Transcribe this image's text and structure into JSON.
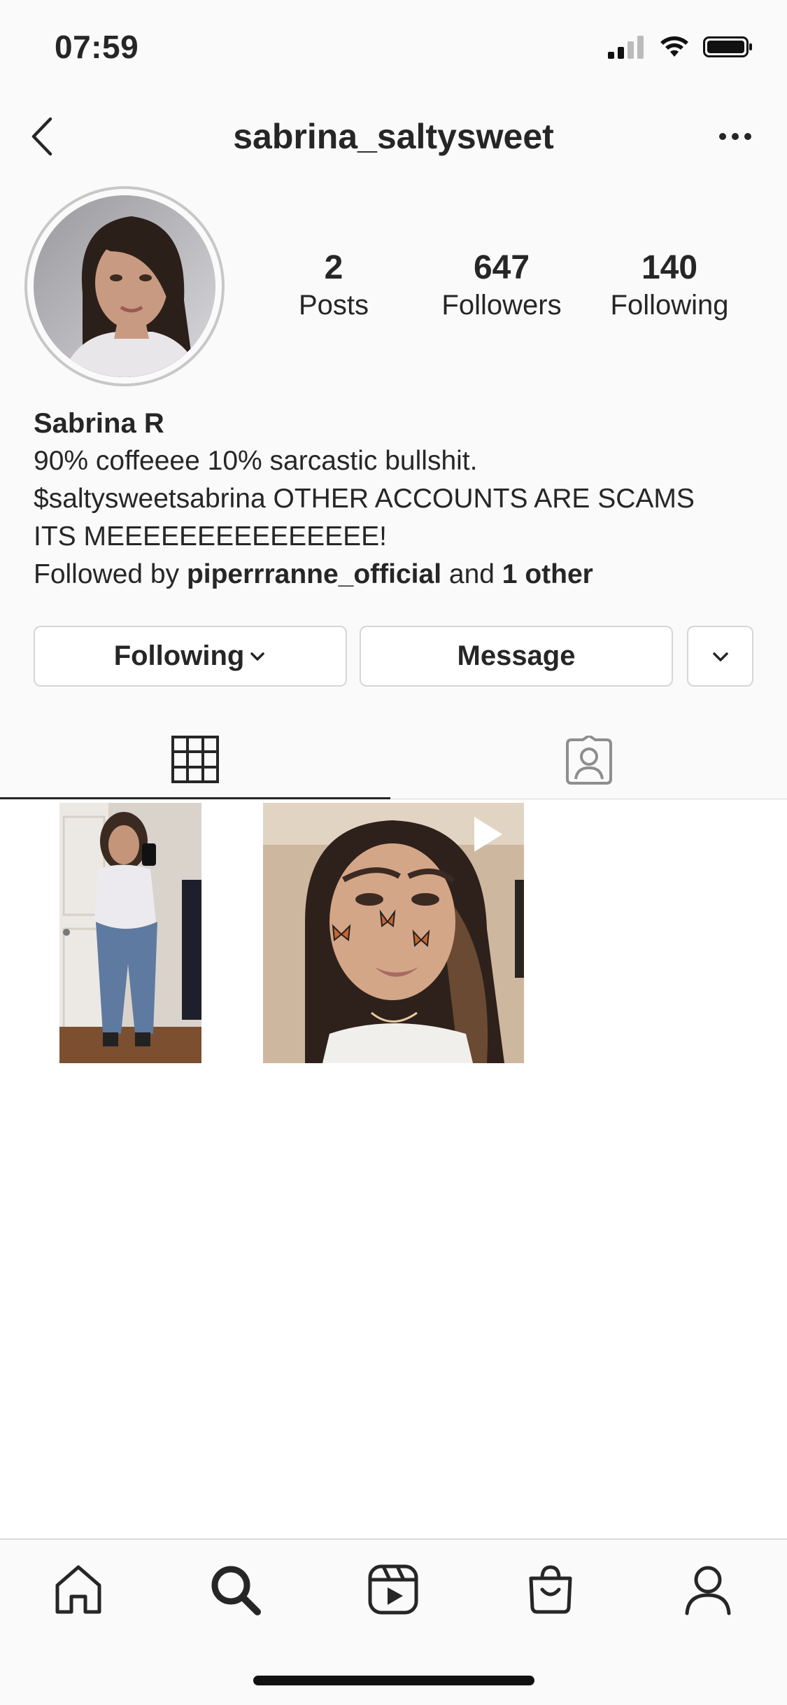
{
  "status_bar": {
    "time": "07:59",
    "icons": [
      "cellular-signal-icon",
      "wifi-icon",
      "battery-icon"
    ]
  },
  "header": {
    "username": "sabrina_saltysweet",
    "back_icon": "chevron-left-icon",
    "more_icon": "ellipsis-icon"
  },
  "profile": {
    "stats": [
      {
        "value": "2",
        "label": "Posts"
      },
      {
        "value": "647",
        "label": "Followers"
      },
      {
        "value": "140",
        "label": "Following"
      }
    ],
    "name": "Sabrina R",
    "bio_line_1": "90% coffeeee 10% sarcastic bullshit.",
    "bio_line_2": "$saltysweetsabrina OTHER ACCOUNTS ARE SCAMS",
    "bio_line_3": "ITS MEEEEEEEEEEEEEEE!",
    "followed_by_prefix": "Followed by ",
    "followed_by_user": "piperrranne_official",
    "followed_by_mid": " and ",
    "followed_by_others": "1 other"
  },
  "actions": {
    "following_label": "Following",
    "message_label": "Message"
  },
  "tabs": [
    "grid-icon",
    "tagged-person-icon"
  ],
  "posts": [
    {
      "type": "photo",
      "subject": "mirror selfie"
    },
    {
      "type": "reel",
      "subject": "butterfly filter selfie"
    }
  ],
  "bottom_nav": [
    "home-icon",
    "search-icon",
    "reels-icon",
    "shop-icon",
    "profile-icon"
  ],
  "colors": {
    "background": "#fafafa",
    "text": "#262626",
    "border": "#dbdbdb"
  }
}
